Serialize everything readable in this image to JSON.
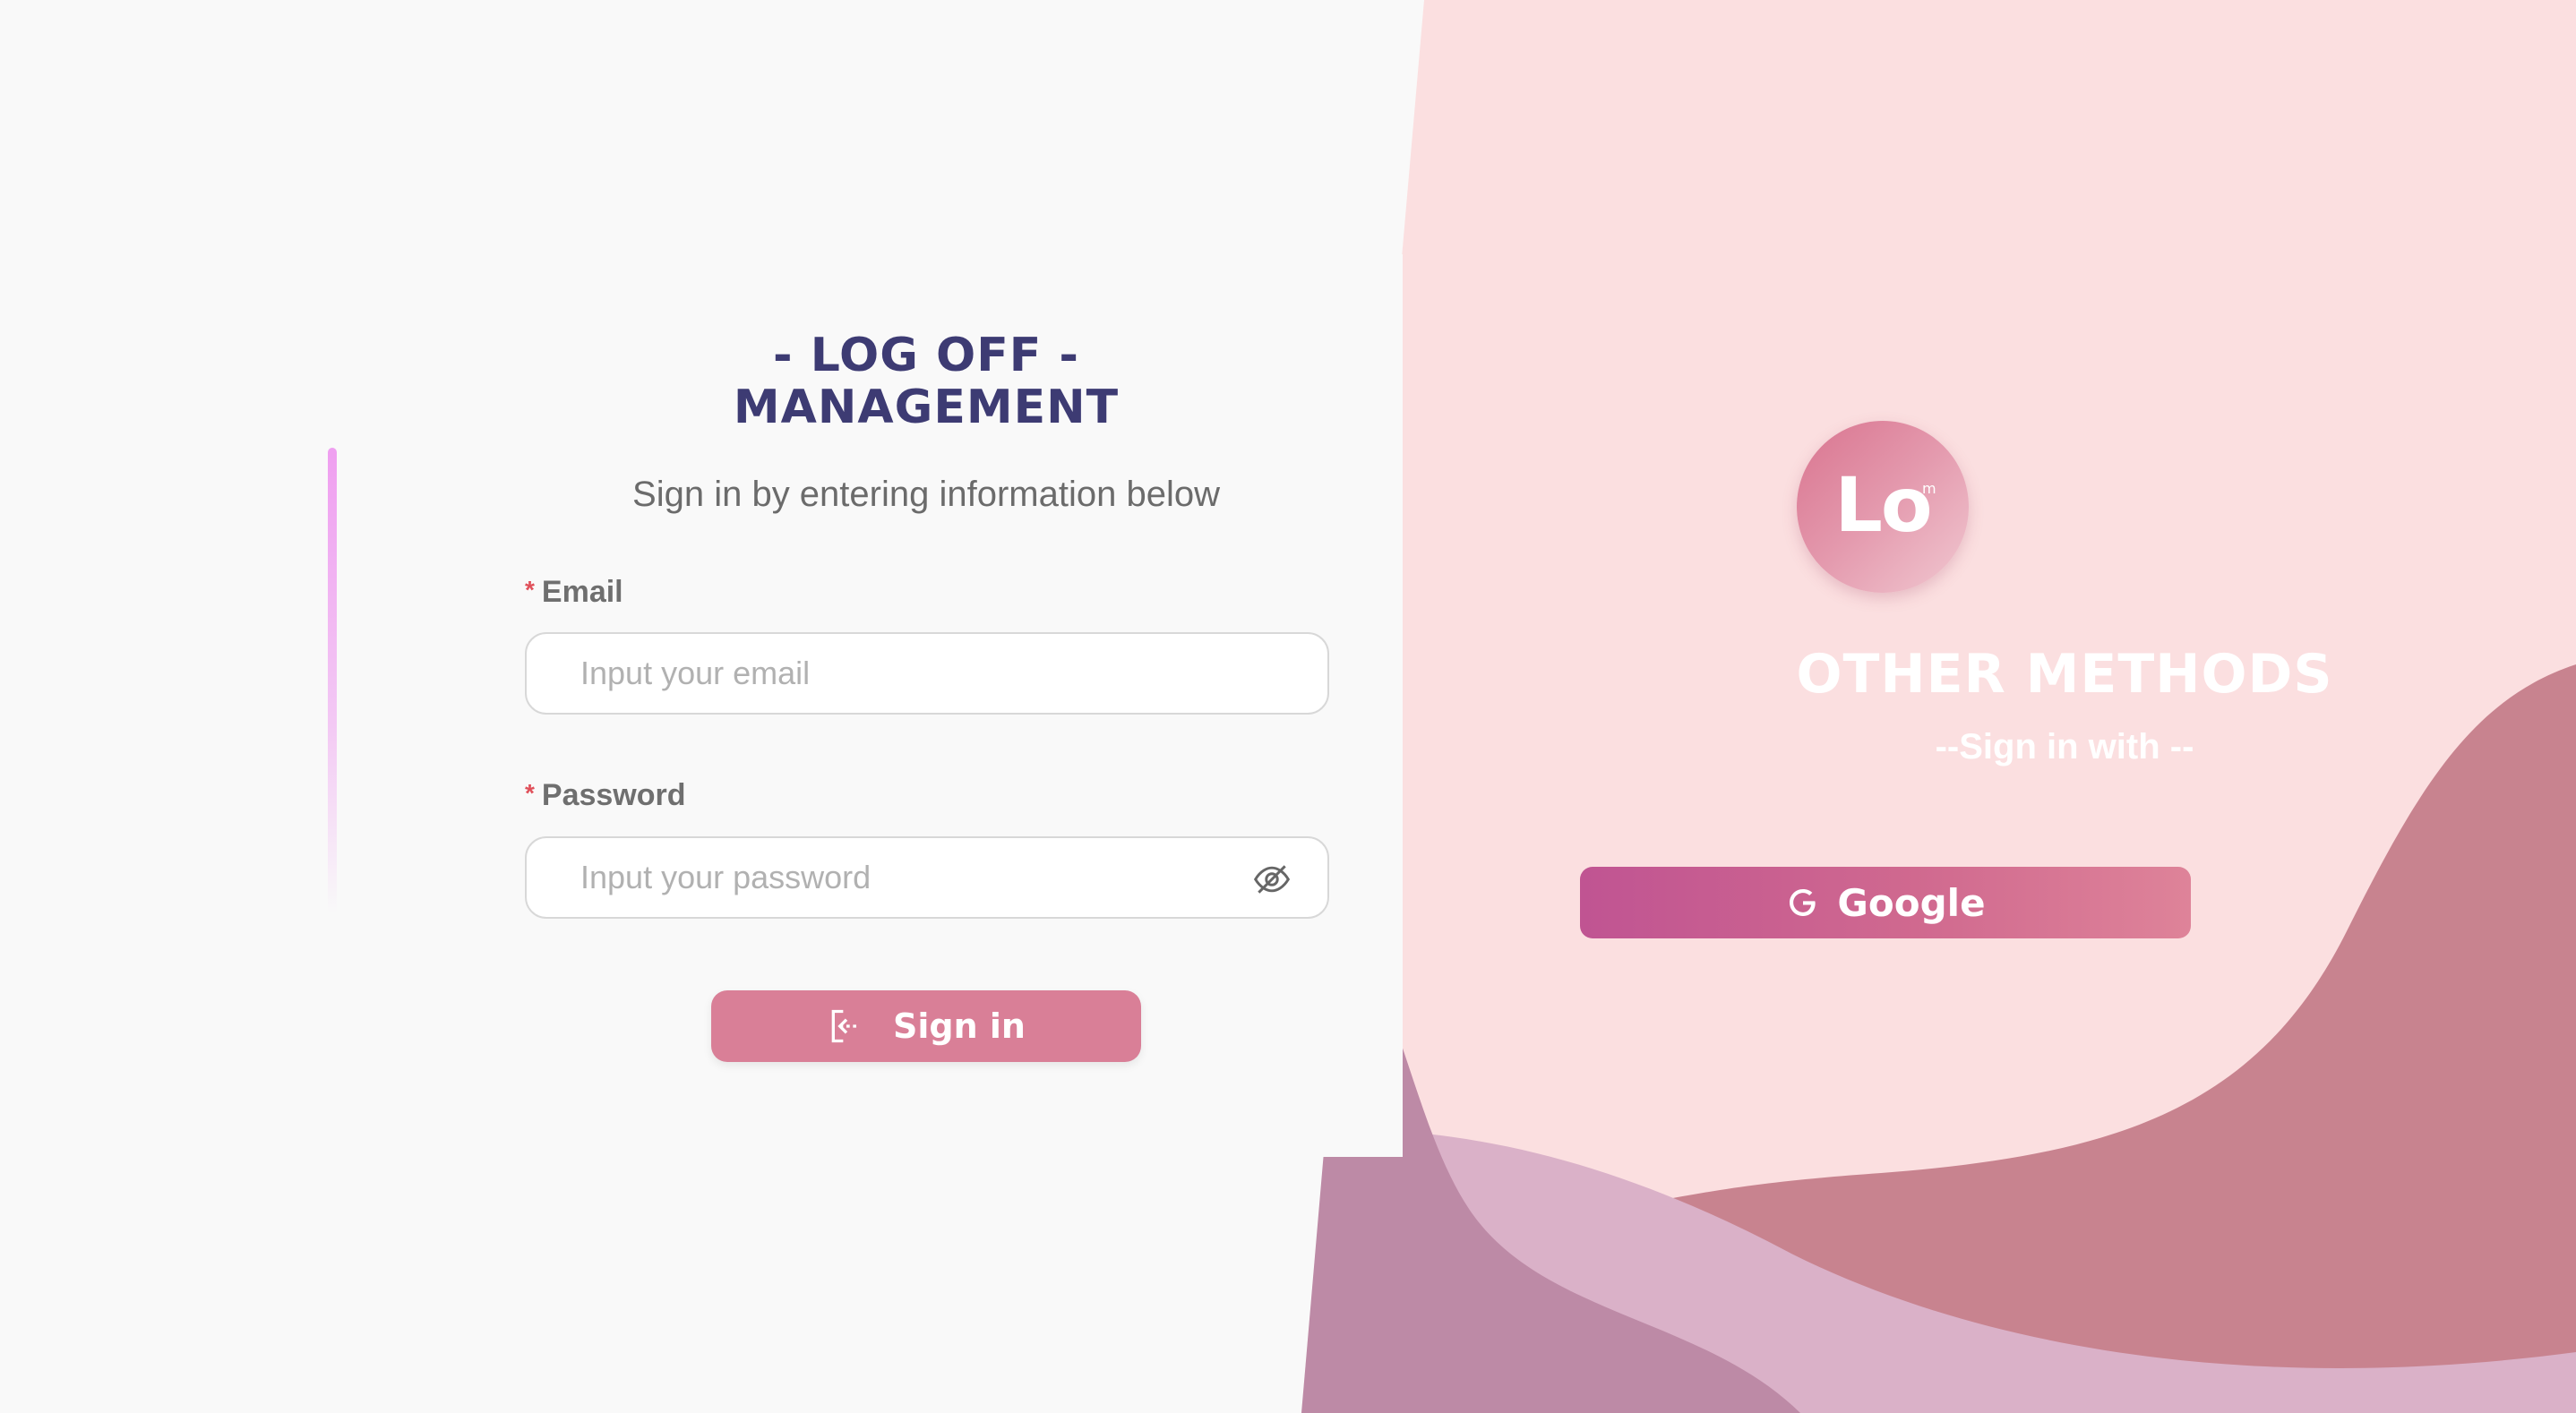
{
  "login": {
    "title_line1": "- LOG OFF -",
    "title_line2": "MANAGEMENT",
    "subtitle": "Sign in by entering information below",
    "email_label": "Email",
    "email_placeholder": "Input your email",
    "password_label": "Password",
    "password_placeholder": "Input your password",
    "required_mark": "*",
    "signin_label": "Sign in"
  },
  "alt": {
    "logo_text": "Lo",
    "logo_mark": "m",
    "title": "OTHER METHODS",
    "subtitle": "--Sign in with --",
    "google_label": "Google"
  },
  "icons": {
    "eye": "eye-off-icon",
    "signin": "sign-in-icon",
    "google": "google-icon"
  },
  "colors": {
    "title": "#3d3b73",
    "accent_button": "#d97f97",
    "right_bg": "#fbdfe0",
    "wave_dark": "#c8838f",
    "wave_light": "#dab1c8",
    "wave_mid": "#bd8aa6"
  }
}
